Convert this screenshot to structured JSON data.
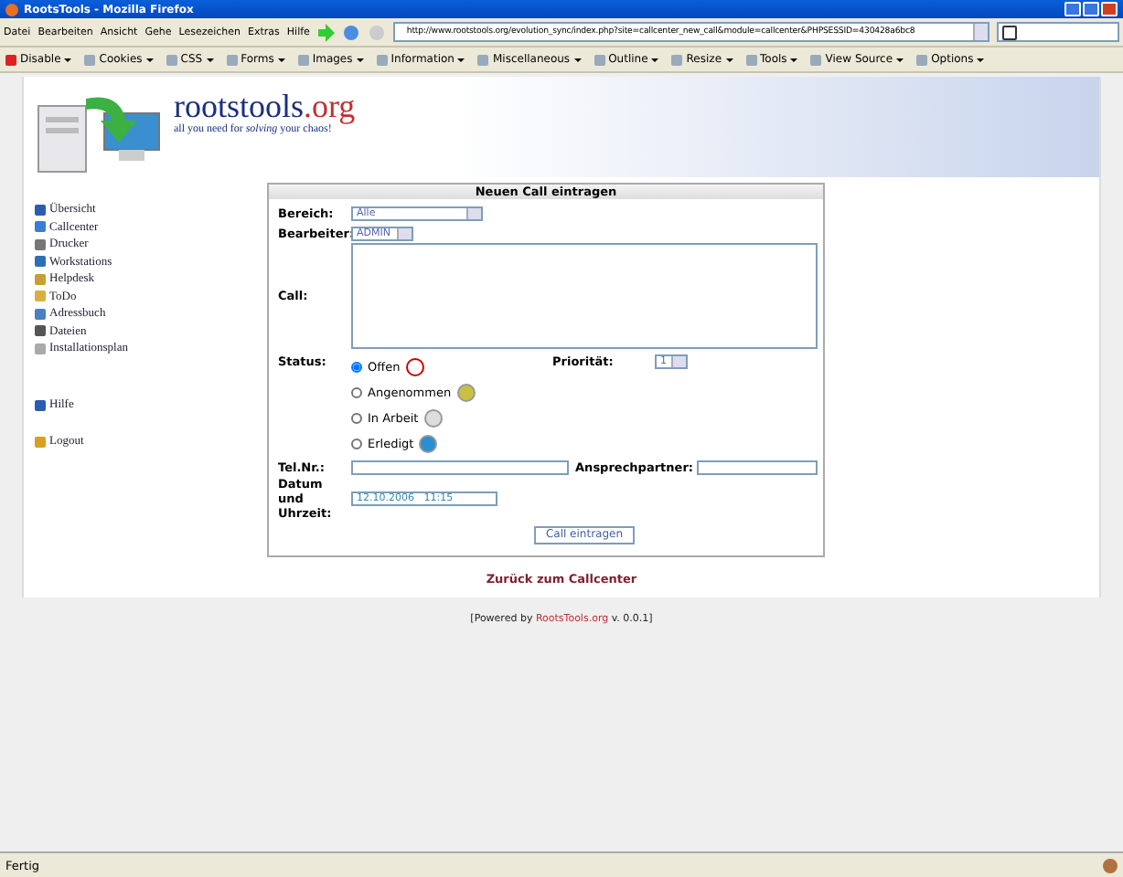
{
  "window": {
    "title": "RootsTools - Mozilla Firefox"
  },
  "menu": [
    "Datei",
    "Bearbeiten",
    "Ansicht",
    "Gehe",
    "Lesezeichen",
    "Extras",
    "Hilfe"
  ],
  "address": {
    "url": "http://www.rootstools.org/evolution_sync/index.php?site=callcenter_new_call&module=callcenter&PHPSESSID=430428a6bc8"
  },
  "toolbar": [
    "Disable",
    "Cookies",
    "CSS",
    "Forms",
    "Images",
    "Information",
    "Miscellaneous",
    "Outline",
    "Resize",
    "Tools",
    "View Source",
    "Options"
  ],
  "logo": {
    "name": "rootstools",
    "tld": ".org",
    "tagline": "all you need for *solving* your chaos!"
  },
  "sidebar": {
    "items": [
      {
        "label": "Übersicht"
      },
      {
        "label": "Callcenter"
      },
      {
        "label": "Drucker"
      },
      {
        "label": "Workstations"
      },
      {
        "label": "Helpdesk"
      },
      {
        "label": "ToDo"
      },
      {
        "label": "Adressbuch"
      },
      {
        "label": "Dateien"
      },
      {
        "label": "Installationsplan"
      }
    ],
    "extra": [
      {
        "label": "Hilfe"
      },
      {
        "label": "Logout"
      }
    ]
  },
  "form": {
    "title": "Neuen Call eintragen",
    "bereich": {
      "label": "Bereich:",
      "value": "Alle"
    },
    "bearbeiter": {
      "label": "Bearbeiter:",
      "value": "ADMIN"
    },
    "call": {
      "label": "Call:"
    },
    "status": {
      "label": "Status:",
      "options": [
        {
          "label": "Offen",
          "selected": true
        },
        {
          "label": "Angenommen",
          "selected": false
        },
        {
          "label": "In Arbeit",
          "selected": false
        },
        {
          "label": "Erledigt",
          "selected": false
        }
      ]
    },
    "prioritaet": {
      "label": "Priorität:",
      "value": "1"
    },
    "tel": {
      "label": "Tel.Nr.:"
    },
    "ansprech": {
      "label": "Ansprechpartner:"
    },
    "datum": {
      "label": "Datum und Uhrzeit:",
      "value": "12.10.2006   11:15"
    },
    "submit": "Call eintragen"
  },
  "back_link": "Zurück zum Callcenter",
  "footer": {
    "before": "[Powered by ",
    "link": "RootsTools.org",
    "after": " v. 0.0.1]"
  },
  "status_bar": "Fertig"
}
